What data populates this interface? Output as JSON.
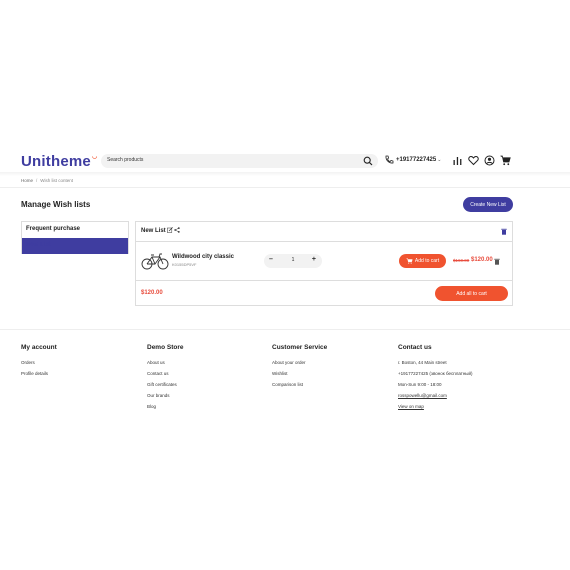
{
  "header": {
    "logo": "Unitheme",
    "search_placeholder": "Search products",
    "phone": "+19177227425",
    "icons": [
      "chart-icon",
      "heart-icon",
      "user-icon",
      "cart-icon"
    ]
  },
  "breadcrumb": [
    "Home",
    "Wish list content"
  ],
  "page_title": "Manage Wish lists",
  "create_button": "Create New List",
  "sidebar": {
    "items": [
      "Frequent purchase",
      "New List"
    ]
  },
  "wishlist": {
    "name": "New List",
    "product": {
      "name": "Wildwood city classic",
      "code": "K0155DP5VF",
      "quantity": "1",
      "old_price": "$160.00",
      "new_price": "$120.00",
      "add_label": "Add to cart"
    },
    "total": "$120.00",
    "add_all_label": "Add all to cart"
  },
  "footer": {
    "col1": {
      "title": "My account",
      "links": [
        "Orders",
        "Profile details"
      ]
    },
    "col2": {
      "title": "Demo Store",
      "links": [
        "About us",
        "Contact us",
        "Gift certificates",
        "Our brands",
        "Blog"
      ]
    },
    "col3": {
      "title": "Customer Service",
      "links": [
        "About your order",
        "Wishlist",
        "Comparison list"
      ]
    },
    "col4": {
      "title": "Contact us",
      "lines": [
        "г. Boston, 44 Main street",
        "+19177227425 (звонок бесплатный)",
        "Mon-Sun 9:00 - 18:00",
        "rosspowellu@gmail.com",
        "View on map"
      ]
    }
  },
  "colors": {
    "brand": "#3f3da0",
    "accent": "#f0532f",
    "price": "#e84c3d"
  }
}
